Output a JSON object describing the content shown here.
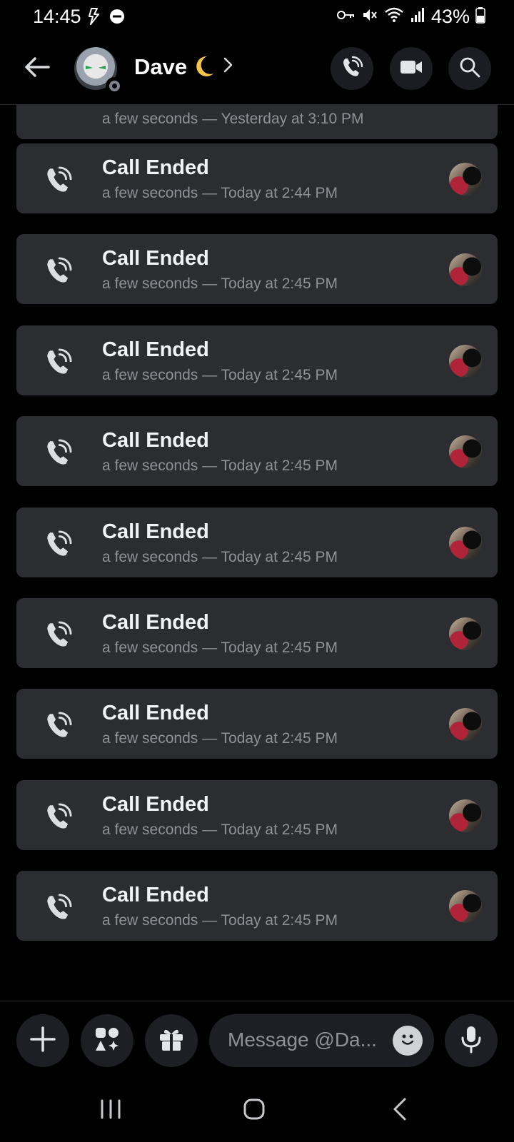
{
  "status_bar": {
    "time": "14:45",
    "battery": "43%"
  },
  "header": {
    "name": "Dave",
    "moon_emoji": "moon-emoji",
    "icons": [
      "back-arrow-icon",
      "voice-call-icon",
      "video-call-icon",
      "search-icon"
    ]
  },
  "messages": {
    "partial_card": {
      "subtitle": "a few seconds — Yesterday at 3:10 PM"
    },
    "calls": [
      {
        "title": "Call Ended",
        "subtitle": "a few seconds — Today at 2:44 PM"
      },
      {
        "title": "Call Ended",
        "subtitle": "a few seconds — Today at 2:45 PM"
      },
      {
        "title": "Call Ended",
        "subtitle": "a few seconds — Today at 2:45 PM"
      },
      {
        "title": "Call Ended",
        "subtitle": "a few seconds — Today at 2:45 PM"
      },
      {
        "title": "Call Ended",
        "subtitle": "a few seconds — Today at 2:45 PM"
      },
      {
        "title": "Call Ended",
        "subtitle": "a few seconds — Today at 2:45 PM"
      },
      {
        "title": "Call Ended",
        "subtitle": "a few seconds — Today at 2:45 PM"
      },
      {
        "title": "Call Ended",
        "subtitle": "a few seconds — Today at 2:45 PM"
      },
      {
        "title": "Call Ended",
        "subtitle": "a few seconds — Today at 2:45 PM"
      }
    ]
  },
  "composer": {
    "placeholder": "Message @Da...",
    "icons": [
      "plus-icon",
      "apps-icon",
      "gift-icon",
      "emoji-icon",
      "microphone-icon"
    ]
  },
  "colors": {
    "background": "#000000",
    "card": "#2b2d31",
    "muted_text": "#8e9297",
    "button_bg": "#1e1f24"
  }
}
